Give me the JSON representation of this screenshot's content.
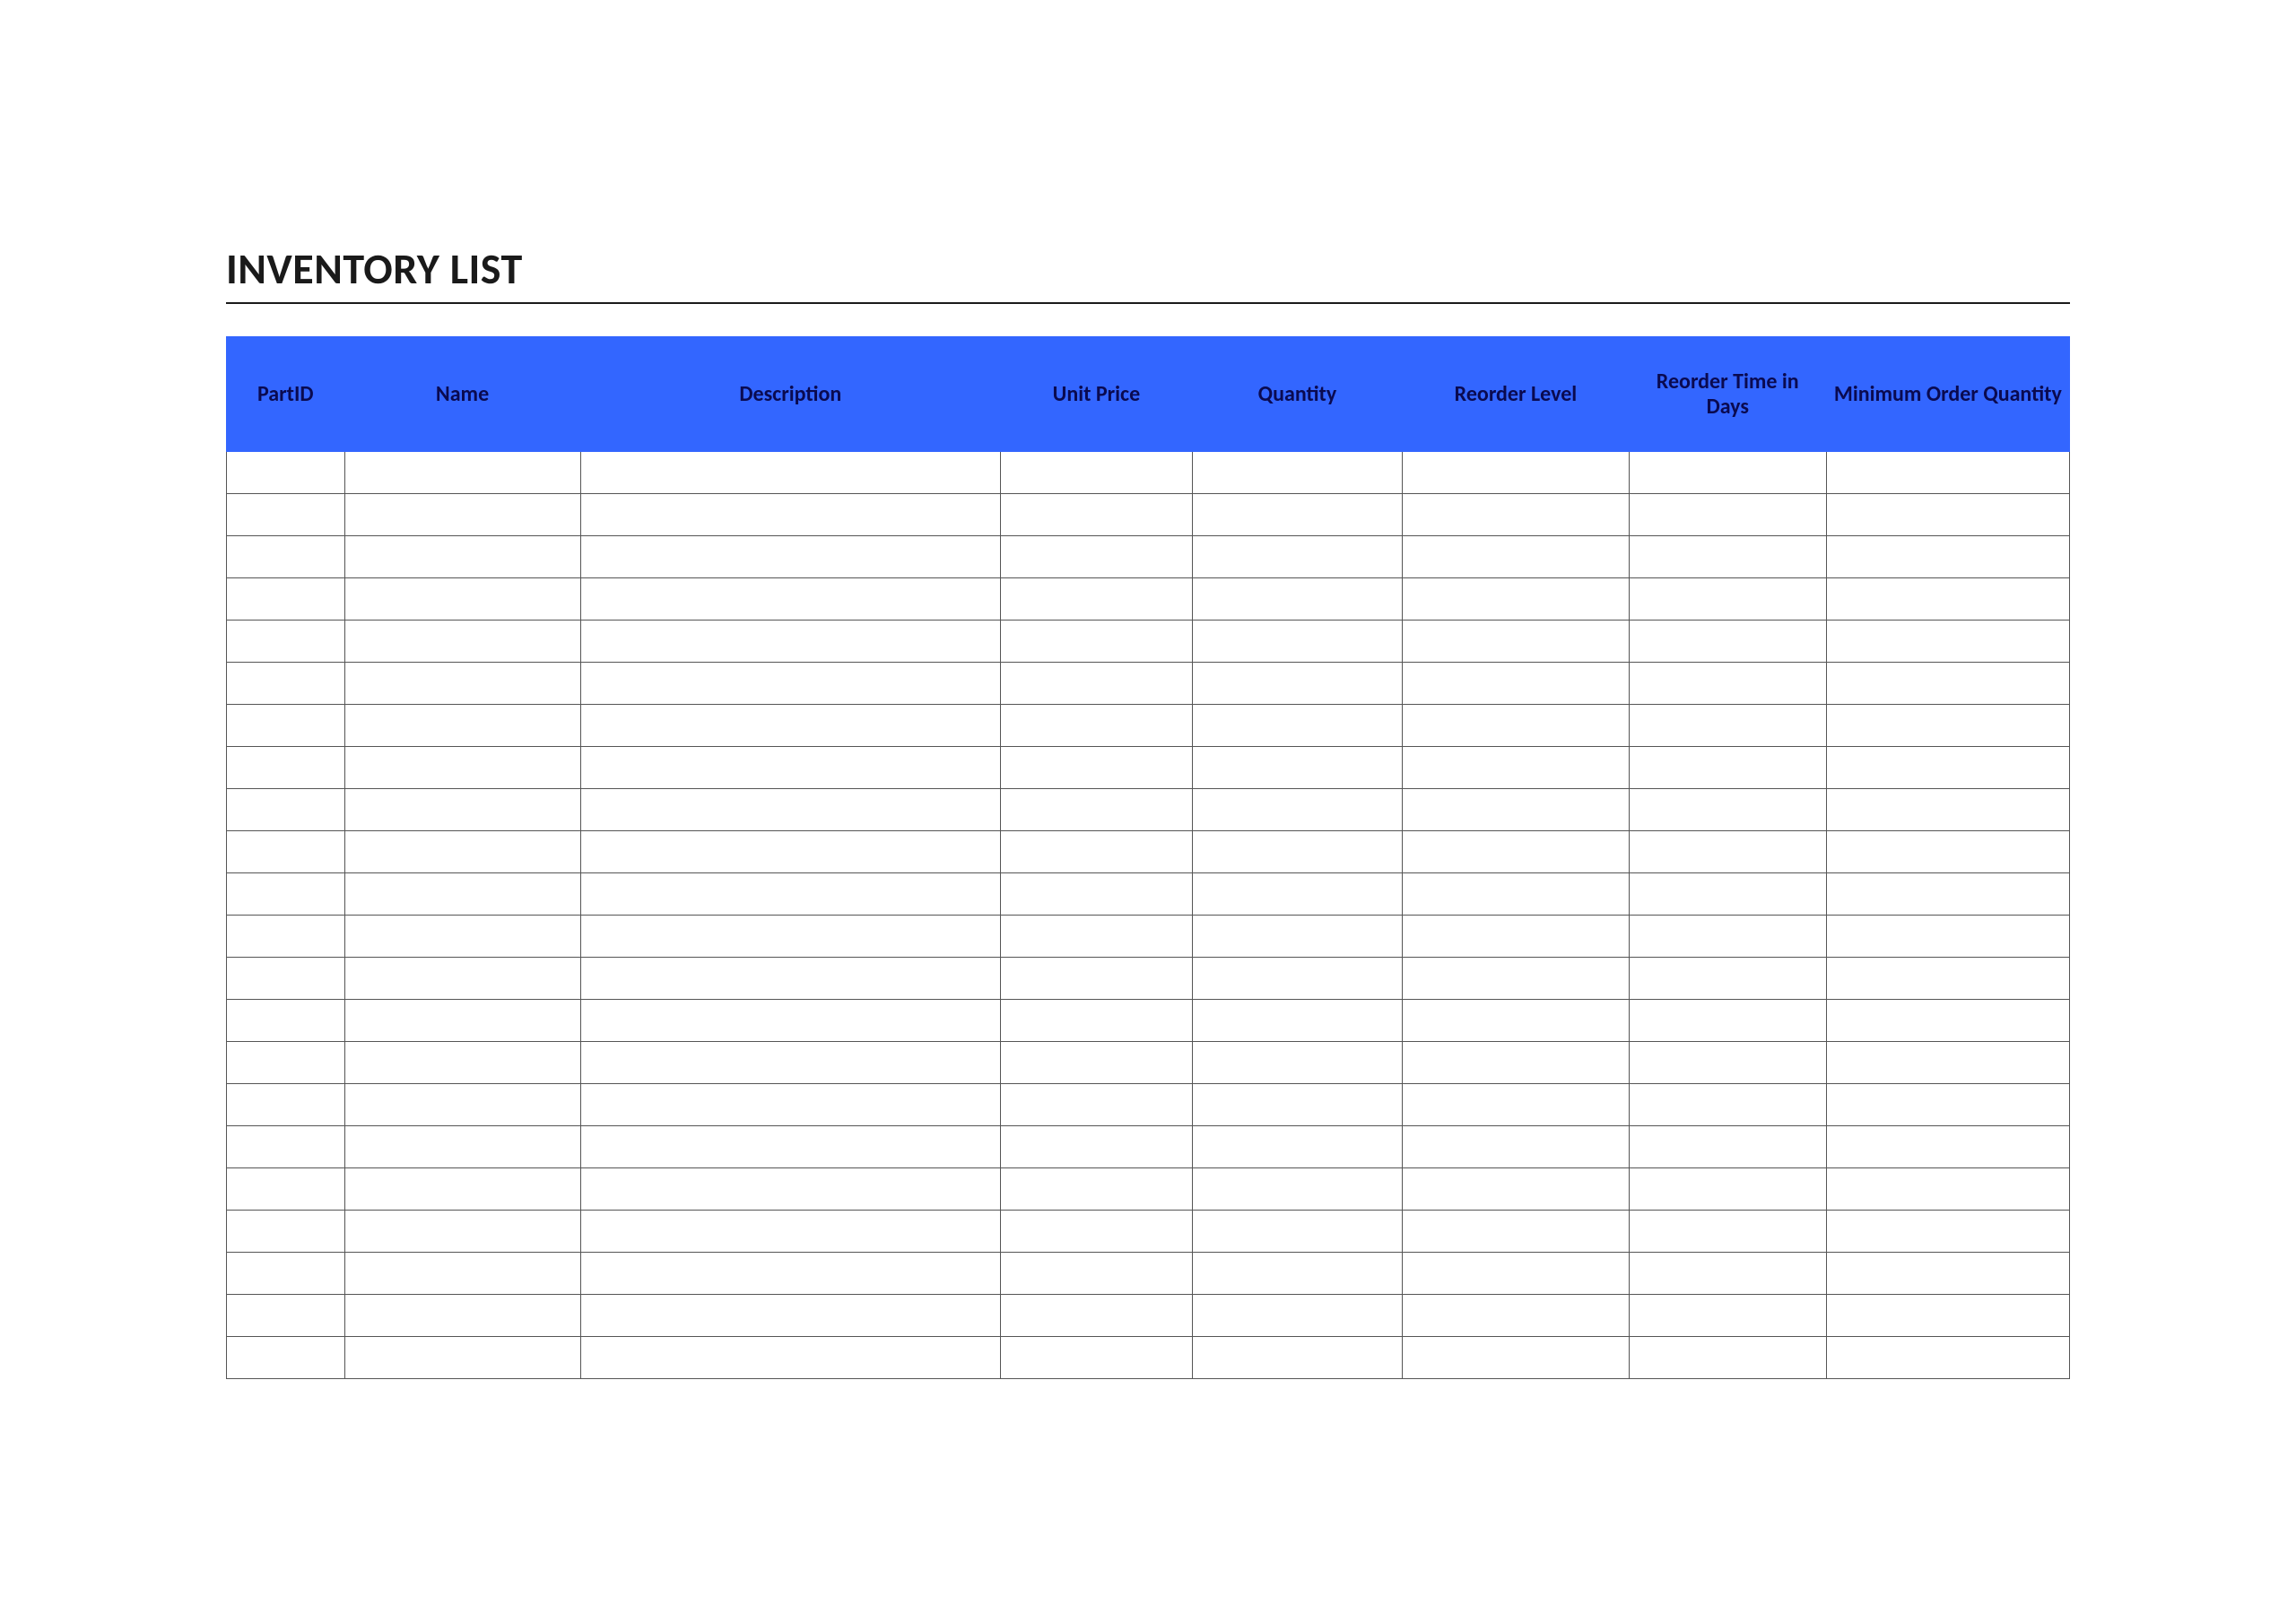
{
  "title": "INVENTORY LIST",
  "columns": [
    "PartID",
    "Name",
    "Description",
    "Unit Price",
    "Quantity",
    "Reorder Level",
    "Reorder Time in Days",
    "Minimum Order Quantity"
  ],
  "row_count": 22,
  "rows": []
}
